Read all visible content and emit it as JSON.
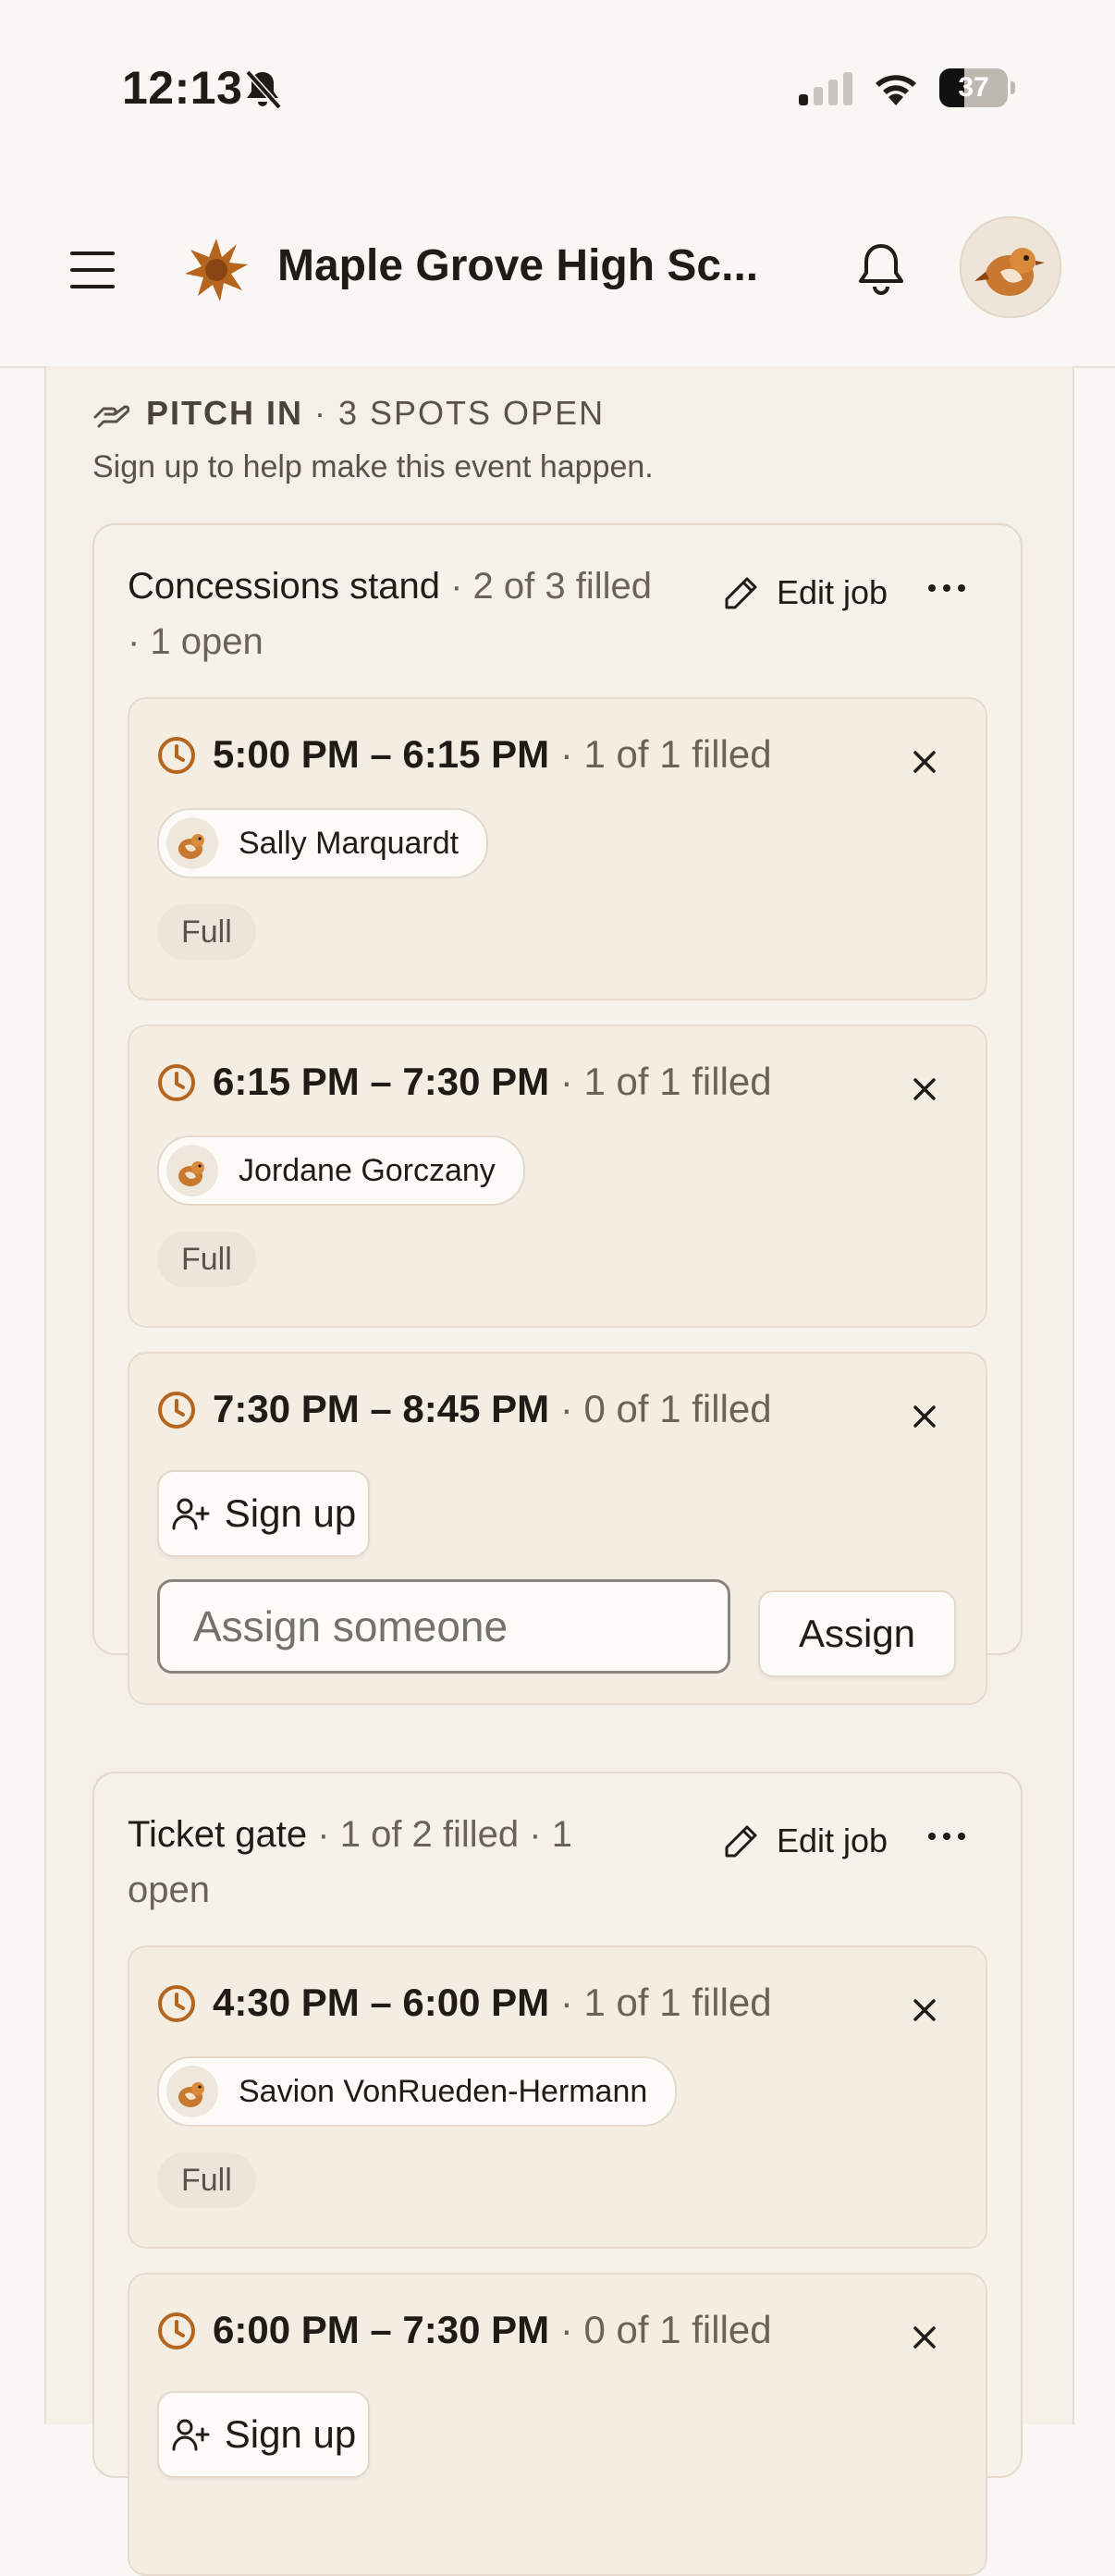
{
  "status_bar": {
    "time": "12:13",
    "battery": "37",
    "battery_level": 0.37
  },
  "header": {
    "org_name": "Maple Grove High Sc..."
  },
  "pitch_in": {
    "label": "PITCH IN",
    "spots": "· 3 SPOTS OPEN",
    "subtitle": "Sign up to help make this event happen."
  },
  "jobs": [
    {
      "name": "Concessions stand",
      "summary": " · 2 of 3 filled · 1 open",
      "edit_label": "Edit job",
      "shifts": [
        {
          "time": "5:00 PM – 6:15 PM",
          "filled": " · 1 of 1 filled",
          "volunteer": "Sally Marquardt",
          "status": "Full"
        },
        {
          "time": "6:15 PM – 7:30 PM",
          "filled": " · 1 of 1 filled",
          "volunteer": "Jordane Gorczany",
          "status": "Full"
        },
        {
          "time": "7:30 PM – 8:45 PM",
          "filled": " · 0 of 1 filled",
          "signup_label": "Sign up",
          "assign_placeholder": "Assign someone",
          "assign_label": "Assign"
        }
      ]
    },
    {
      "name": "Ticket gate",
      "summary": " · 1 of 2 filled · 1 open",
      "edit_label": "Edit job",
      "shifts": [
        {
          "time": "4:30 PM – 6:00 PM",
          "filled": " · 1 of 1 filled",
          "volunteer": "Savion VonRueden-Hermann",
          "status": "Full"
        },
        {
          "time": "6:00 PM – 7:30 PM",
          "filled": " · 0 of 1 filled",
          "signup_label": "Sign up"
        }
      ]
    }
  ],
  "colors": {
    "accent": "#b5651d",
    "background": "#f9f7f3",
    "card": "#f6f2ea"
  }
}
